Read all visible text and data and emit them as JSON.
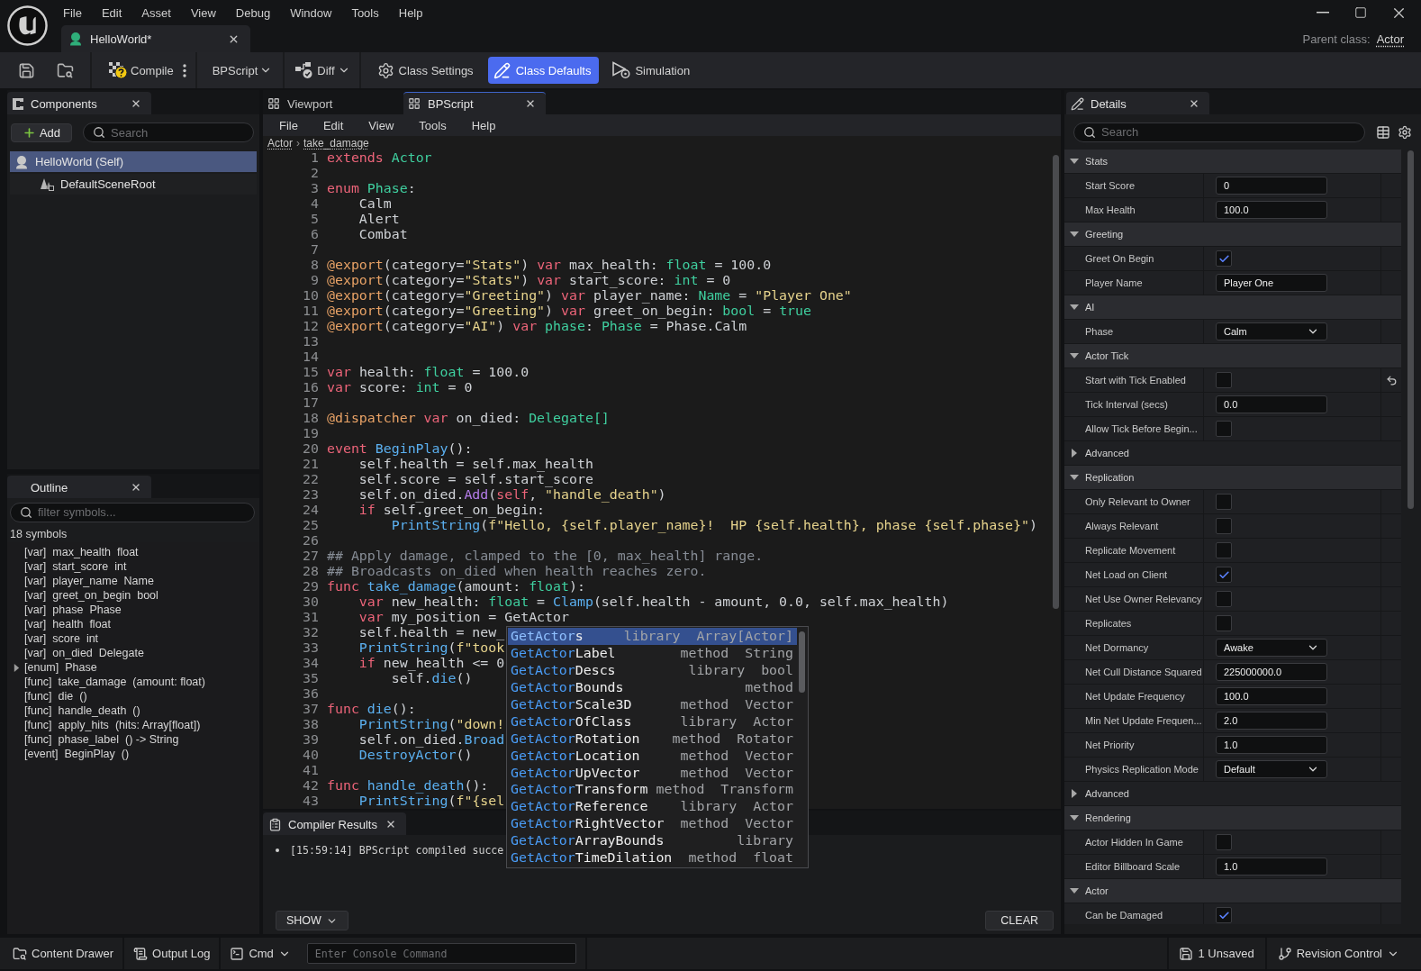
{
  "menu_bar": {
    "items": [
      "File",
      "Edit",
      "Asset",
      "View",
      "Debug",
      "Window",
      "Tools",
      "Help"
    ]
  },
  "document_tab": {
    "title": "HelloWorld*"
  },
  "parent_class": {
    "label": "Parent class:",
    "value": "Actor"
  },
  "toolbar": {
    "compile": "Compile",
    "script": "BPScript",
    "diff": "Diff",
    "modes": [
      {
        "label": "Class Settings",
        "selected": false
      },
      {
        "label": "Class Defaults",
        "selected": true
      },
      {
        "label": "Simulation",
        "selected": false
      }
    ]
  },
  "components_panel": {
    "title": "Components",
    "add_button": "Add",
    "search": {
      "placeholder": "Search"
    },
    "tree": [
      {
        "label": "HelloWorld (Self)",
        "selected": true,
        "children": [
          {
            "label": "DefaultSceneRoot",
            "selected": false
          }
        ]
      }
    ]
  },
  "outline_panel": {
    "title": "Outline",
    "filter": {
      "placeholder": "filter symbols..."
    },
    "count": "18 symbols",
    "symbols": [
      {
        "tag": "[var]",
        "name": "max_health",
        "detail": "float"
      },
      {
        "tag": "[var]",
        "name": "start_score",
        "detail": "int"
      },
      {
        "tag": "[var]",
        "name": "player_name",
        "detail": "Name"
      },
      {
        "tag": "[var]",
        "name": "greet_on_begin",
        "detail": "bool"
      },
      {
        "tag": "[var]",
        "name": "phase",
        "detail": "Phase"
      },
      {
        "tag": "[var]",
        "name": "health",
        "detail": "float"
      },
      {
        "tag": "[var]",
        "name": "score",
        "detail": "int"
      },
      {
        "tag": "[var]",
        "name": "on_died",
        "detail": "Delegate"
      },
      {
        "tag": "[enum]",
        "name": "Phase",
        "expanded": false
      },
      {
        "tag": "[func]",
        "name": "take_damage",
        "detail": "(amount: float)"
      },
      {
        "tag": "[func]",
        "name": "die",
        "detail": "()"
      },
      {
        "tag": "[func]",
        "name": "handle_death",
        "detail": "()"
      },
      {
        "tag": "[func]",
        "name": "apply_hits",
        "detail": "(hits: Array[float])"
      },
      {
        "tag": "[func]",
        "name": "phase_label",
        "detail": "() -> String"
      },
      {
        "tag": "[event]",
        "name": "BeginPlay",
        "detail": "()"
      }
    ]
  },
  "editor": {
    "tabs": [
      {
        "label": "Viewport",
        "selected": false
      },
      {
        "label": "BPScript",
        "selected": true
      }
    ],
    "menu": [
      "File",
      "Edit",
      "View",
      "Tools",
      "Help"
    ],
    "breadcrumb": {
      "items": [
        "Actor",
        "take_damage"
      ],
      "separator": "›"
    },
    "lines": [
      {
        "number": "1",
        "tokens": [
          {
            "kind": "keyword",
            "text": "extends "
          },
          {
            "kind": "type",
            "text": "Actor"
          }
        ]
      },
      {
        "number": "2"
      },
      {
        "number": "3",
        "tokens": [
          {
            "kind": "keyword",
            "text": "enum "
          },
          {
            "kind": "type",
            "text": "Phase"
          },
          {
            "kind": "plain",
            "text": ":"
          }
        ]
      },
      {
        "number": "4",
        "tokens": [
          {
            "kind": "plain",
            "text": "    Calm"
          }
        ]
      },
      {
        "number": "5",
        "tokens": [
          {
            "kind": "plain",
            "text": "    Alert"
          }
        ]
      },
      {
        "number": "6",
        "tokens": [
          {
            "kind": "plain",
            "text": "    Combat"
          }
        ]
      },
      {
        "number": "7"
      },
      {
        "number": "8",
        "tokens": [
          {
            "kind": "decorator",
            "text": "@export"
          },
          {
            "kind": "plain",
            "text": "(category="
          },
          {
            "kind": "string",
            "text": "\"Stats\""
          },
          {
            "kind": "plain",
            "text": ") "
          },
          {
            "kind": "keyword",
            "text": "var "
          },
          {
            "kind": "plain",
            "text": "max_health: "
          },
          {
            "kind": "type",
            "text": "float"
          },
          {
            "kind": "plain",
            "text": " = 100.0"
          }
        ]
      },
      {
        "number": "9",
        "tokens": [
          {
            "kind": "decorator",
            "text": "@export"
          },
          {
            "kind": "plain",
            "text": "(category="
          },
          {
            "kind": "string",
            "text": "\"Stats\""
          },
          {
            "kind": "plain",
            "text": ") "
          },
          {
            "kind": "keyword",
            "text": "var "
          },
          {
            "kind": "plain",
            "text": "start_score: "
          },
          {
            "kind": "type",
            "text": "int"
          },
          {
            "kind": "plain",
            "text": " = 0"
          }
        ]
      },
      {
        "number": "10",
        "tokens": [
          {
            "kind": "decorator",
            "text": "@export"
          },
          {
            "kind": "plain",
            "text": "(category="
          },
          {
            "kind": "string",
            "text": "\"Greeting\""
          },
          {
            "kind": "plain",
            "text": ") "
          },
          {
            "kind": "keyword",
            "text": "var "
          },
          {
            "kind": "plain",
            "text": "player_name: "
          },
          {
            "kind": "type",
            "text": "Name"
          },
          {
            "kind": "plain",
            "text": " = "
          },
          {
            "kind": "string",
            "text": "\"Player One\""
          }
        ]
      },
      {
        "number": "11",
        "tokens": [
          {
            "kind": "decorator",
            "text": "@export"
          },
          {
            "kind": "plain",
            "text": "(category="
          },
          {
            "kind": "string",
            "text": "\"Greeting\""
          },
          {
            "kind": "plain",
            "text": ") "
          },
          {
            "kind": "keyword",
            "text": "var "
          },
          {
            "kind": "plain",
            "text": "greet_on_begin: "
          },
          {
            "kind": "type",
            "text": "bool"
          },
          {
            "kind": "plain",
            "text": " = "
          },
          {
            "kind": "constant",
            "text": "true"
          }
        ]
      },
      {
        "number": "12",
        "tokens": [
          {
            "kind": "decorator",
            "text": "@export"
          },
          {
            "kind": "plain",
            "text": "(category="
          },
          {
            "kind": "string",
            "text": "\"AI\""
          },
          {
            "kind": "plain",
            "text": ") "
          },
          {
            "kind": "keyword",
            "text": "var "
          },
          {
            "kind": "type",
            "text": "phase"
          },
          {
            "kind": "plain",
            "text": ": "
          },
          {
            "kind": "type",
            "text": "Phase"
          },
          {
            "kind": "plain",
            "text": " = Phase.Calm"
          }
        ]
      },
      {
        "number": "13"
      },
      {
        "number": "14"
      },
      {
        "number": "15",
        "tokens": [
          {
            "kind": "keyword",
            "text": "var "
          },
          {
            "kind": "plain",
            "text": "health: "
          },
          {
            "kind": "type",
            "text": "float"
          },
          {
            "kind": "plain",
            "text": " = 100.0"
          }
        ]
      },
      {
        "number": "16",
        "tokens": [
          {
            "kind": "keyword",
            "text": "var "
          },
          {
            "kind": "plain",
            "text": "score: "
          },
          {
            "kind": "type",
            "text": "int"
          },
          {
            "kind": "plain",
            "text": " = 0"
          }
        ]
      },
      {
        "number": "17"
      },
      {
        "number": "18",
        "tokens": [
          {
            "kind": "decorator",
            "text": "@dispatcher "
          },
          {
            "kind": "keyword",
            "text": "var "
          },
          {
            "kind": "plain",
            "text": "on_died: "
          },
          {
            "kind": "type",
            "text": "Delegate[]"
          }
        ]
      },
      {
        "number": "19"
      },
      {
        "number": "20",
        "tokens": [
          {
            "kind": "keyword",
            "text": "event "
          },
          {
            "kind": "function",
            "text": "BeginPlay"
          },
          {
            "kind": "plain",
            "text": "():"
          }
        ]
      },
      {
        "number": "21",
        "tokens": [
          {
            "kind": "plain",
            "text": "    self.health = self.max_health"
          }
        ]
      },
      {
        "number": "22",
        "tokens": [
          {
            "kind": "plain",
            "text": "    self.score = self.start_score"
          }
        ]
      },
      {
        "number": "23",
        "tokens": [
          {
            "kind": "plain",
            "text": "    self.on_died."
          },
          {
            "kind": "method",
            "text": "Add"
          },
          {
            "kind": "plain",
            "text": "("
          },
          {
            "kind": "keyword",
            "text": "self"
          },
          {
            "kind": "plain",
            "text": ", "
          },
          {
            "kind": "string",
            "text": "\"handle_death\""
          },
          {
            "kind": "plain",
            "text": ")"
          }
        ]
      },
      {
        "number": "24",
        "tokens": [
          {
            "kind": "keyword",
            "text": "    if "
          },
          {
            "kind": "plain",
            "text": "self.greet_on_begin:"
          }
        ]
      },
      {
        "number": "25",
        "tokens": [
          {
            "kind": "function",
            "text": "        PrintString"
          },
          {
            "kind": "plain",
            "text": "("
          },
          {
            "kind": "string",
            "text": "f\"Hello, {self.player_name}!  HP {self.health}, phase {self.phase}\""
          },
          {
            "kind": "plain",
            "text": ")"
          }
        ]
      },
      {
        "number": "26"
      },
      {
        "number": "27",
        "tokens": [
          {
            "kind": "comment",
            "text": "## Apply damage, clamped to the [0, max_health] range."
          }
        ]
      },
      {
        "number": "28",
        "tokens": [
          {
            "kind": "comment",
            "text": "## Broadcasts on_died when health reaches zero."
          }
        ]
      },
      {
        "number": "29",
        "tokens": [
          {
            "kind": "keyword",
            "text": "func "
          },
          {
            "kind": "function",
            "text": "take_damage"
          },
          {
            "kind": "plain",
            "text": "(amount: "
          },
          {
            "kind": "type",
            "text": "float"
          },
          {
            "kind": "plain",
            "text": "):"
          }
        ]
      },
      {
        "number": "30",
        "tokens": [
          {
            "kind": "keyword",
            "text": "    var "
          },
          {
            "kind": "plain",
            "text": "new_health: "
          },
          {
            "kind": "type",
            "text": "float"
          },
          {
            "kind": "plain",
            "text": " = "
          },
          {
            "kind": "function",
            "text": "Clamp"
          },
          {
            "kind": "plain",
            "text": "(self.health - amount, 0.0, self.max_health)"
          }
        ]
      },
      {
        "number": "31",
        "tokens": [
          {
            "kind": "keyword",
            "text": "    var "
          },
          {
            "kind": "plain",
            "text": "my_position = GetActor"
          }
        ]
      },
      {
        "number": "32",
        "tokens": [
          {
            "kind": "plain",
            "text": "    self.health = new_"
          }
        ]
      },
      {
        "number": "33",
        "tokens": [
          {
            "kind": "function",
            "text": "    PrintString"
          },
          {
            "kind": "plain",
            "text": "("
          },
          {
            "kind": "string",
            "text": "f\"took"
          }
        ]
      },
      {
        "number": "34",
        "tokens": [
          {
            "kind": "keyword",
            "text": "    if "
          },
          {
            "kind": "plain",
            "text": "new_health <= 0"
          }
        ]
      },
      {
        "number": "35",
        "tokens": [
          {
            "kind": "plain",
            "text": "        self."
          },
          {
            "kind": "function",
            "text": "die"
          },
          {
            "kind": "plain",
            "text": "()"
          }
        ]
      },
      {
        "number": "36"
      },
      {
        "number": "37",
        "tokens": [
          {
            "kind": "keyword",
            "text": "func "
          },
          {
            "kind": "function",
            "text": "die"
          },
          {
            "kind": "plain",
            "text": "():"
          }
        ]
      },
      {
        "number": "38",
        "tokens": [
          {
            "kind": "function",
            "text": "    PrintString"
          },
          {
            "kind": "plain",
            "text": "("
          },
          {
            "kind": "string",
            "text": "\"down!"
          }
        ]
      },
      {
        "number": "39",
        "tokens": [
          {
            "kind": "plain",
            "text": "    self.on_died."
          },
          {
            "kind": "function",
            "text": "Broad"
          }
        ]
      },
      {
        "number": "40",
        "tokens": [
          {
            "kind": "function",
            "text": "    DestroyActor"
          },
          {
            "kind": "plain",
            "text": "()"
          }
        ]
      },
      {
        "number": "41"
      },
      {
        "number": "42",
        "tokens": [
          {
            "kind": "keyword",
            "text": "func "
          },
          {
            "kind": "function",
            "text": "handle_death"
          },
          {
            "kind": "plain",
            "text": "():"
          }
        ]
      },
      {
        "number": "43",
        "tokens": [
          {
            "kind": "function",
            "text": "    PrintString"
          },
          {
            "kind": "plain",
            "text": "("
          },
          {
            "kind": "string",
            "text": "f\"{sel"
          }
        ]
      }
    ],
    "autocomplete": {
      "items": [
        {
          "match": "GetActor",
          "rest": "s",
          "category": "library",
          "type": "Array[Actor]",
          "selected": true
        },
        {
          "match": "GetActor",
          "rest": "Label",
          "category": "method",
          "type": "String",
          "selected": false
        },
        {
          "match": "GetActor",
          "rest": "Descs",
          "category": "library",
          "type": "bool",
          "selected": false
        },
        {
          "match": "GetActor",
          "rest": "Bounds",
          "category": "method",
          "selected": false
        },
        {
          "match": "GetActor",
          "rest": "Scale3D",
          "category": "method",
          "type": "Vector",
          "selected": false
        },
        {
          "match": "GetActor",
          "rest": "OfClass",
          "category": "library",
          "type": "Actor",
          "selected": false
        },
        {
          "match": "GetActor",
          "rest": "Rotation",
          "category": "method",
          "type": "Rotator",
          "selected": false
        },
        {
          "match": "GetActor",
          "rest": "Location",
          "category": "method",
          "type": "Vector",
          "selected": false
        },
        {
          "match": "GetActor",
          "rest": "UpVector",
          "category": "method",
          "type": "Vector",
          "selected": false
        },
        {
          "match": "GetActor",
          "rest": "Transform",
          "category": "method",
          "type": "Transform",
          "selected": false
        },
        {
          "match": "GetActor",
          "rest": "Reference",
          "category": "library",
          "type": "Actor",
          "selected": false
        },
        {
          "match": "GetActor",
          "rest": "RightVector",
          "category": "method",
          "type": "Vector",
          "selected": false
        },
        {
          "match": "GetActor",
          "rest": "ArrayBounds",
          "category": "library",
          "selected": false
        },
        {
          "match": "GetActor",
          "rest": "TimeDilation",
          "category": "method",
          "type": "float",
          "selected": false
        }
      ]
    }
  },
  "compiler_results": {
    "title": "Compiler Results",
    "messages": [
      "[15:59:14] BPScript compiled succe"
    ],
    "show_button": "SHOW",
    "clear_button": "CLEAR"
  },
  "details_panel": {
    "title": "Details",
    "search": {
      "placeholder": "Search"
    },
    "sections": [
      {
        "title": "Stats",
        "expanded": true,
        "rows": [
          {
            "kind": "text",
            "label": "Start Score",
            "value": "0"
          },
          {
            "kind": "text",
            "label": "Max Health",
            "value": "100.0"
          }
        ]
      },
      {
        "title": "Greeting",
        "expanded": true,
        "rows": [
          {
            "kind": "checkbox",
            "label": "Greet On Begin",
            "checked": true
          },
          {
            "kind": "text",
            "label": "Player Name",
            "value": "Player One"
          }
        ]
      },
      {
        "title": "AI",
        "expanded": true,
        "rows": [
          {
            "kind": "dropdown",
            "label": "Phase",
            "value": "Calm"
          }
        ]
      },
      {
        "title": "Actor Tick",
        "expanded": true,
        "rows": [
          {
            "kind": "checkbox",
            "label": "Start with Tick Enabled",
            "checked": false,
            "reset": true
          },
          {
            "kind": "text",
            "label": "Tick Interval (secs)",
            "value": "0.0"
          },
          {
            "kind": "checkbox",
            "label": "Allow Tick Before Begin...",
            "checked": false
          },
          {
            "kind": "group",
            "label": "Advanced",
            "expanded": false
          }
        ]
      },
      {
        "title": "Replication",
        "expanded": true,
        "rows": [
          {
            "kind": "checkbox",
            "label": "Only Relevant to Owner",
            "checked": false
          },
          {
            "kind": "checkbox",
            "label": "Always Relevant",
            "checked": false
          },
          {
            "kind": "checkbox",
            "label": "Replicate Movement",
            "checked": false
          },
          {
            "kind": "checkbox",
            "label": "Net Load on Client",
            "checked": true
          },
          {
            "kind": "checkbox",
            "label": "Net Use Owner Relevancy",
            "checked": false
          },
          {
            "kind": "checkbox",
            "label": "Replicates",
            "checked": false
          },
          {
            "kind": "dropdown",
            "label": "Net Dormancy",
            "value": "Awake"
          },
          {
            "kind": "text",
            "label": "Net Cull Distance Squared",
            "value": "225000000.0"
          },
          {
            "kind": "text",
            "label": "Net Update Frequency",
            "value": "100.0"
          },
          {
            "kind": "text",
            "label": "Min Net Update Frequen...",
            "value": "2.0"
          },
          {
            "kind": "text",
            "label": "Net Priority",
            "value": "1.0"
          },
          {
            "kind": "dropdown",
            "label": "Physics Replication Mode",
            "value": "Default"
          },
          {
            "kind": "group",
            "label": "Advanced",
            "expanded": false
          }
        ]
      },
      {
        "title": "Rendering",
        "expanded": true,
        "rows": [
          {
            "kind": "checkbox",
            "label": "Actor Hidden In Game",
            "checked": false
          },
          {
            "kind": "text",
            "label": "Editor Billboard Scale",
            "value": "1.0"
          }
        ]
      },
      {
        "title": "Actor",
        "expanded": true,
        "rows": [
          {
            "kind": "checkbox",
            "label": "Can be Damaged",
            "checked": true
          }
        ]
      }
    ]
  },
  "status_bar": {
    "content_drawer": "Content Drawer",
    "output_log": "Output Log",
    "cmd": "Cmd",
    "console": {
      "placeholder": "Enter Console Command"
    },
    "unsaved": "1 Unsaved",
    "revision_control": "Revision Control"
  }
}
